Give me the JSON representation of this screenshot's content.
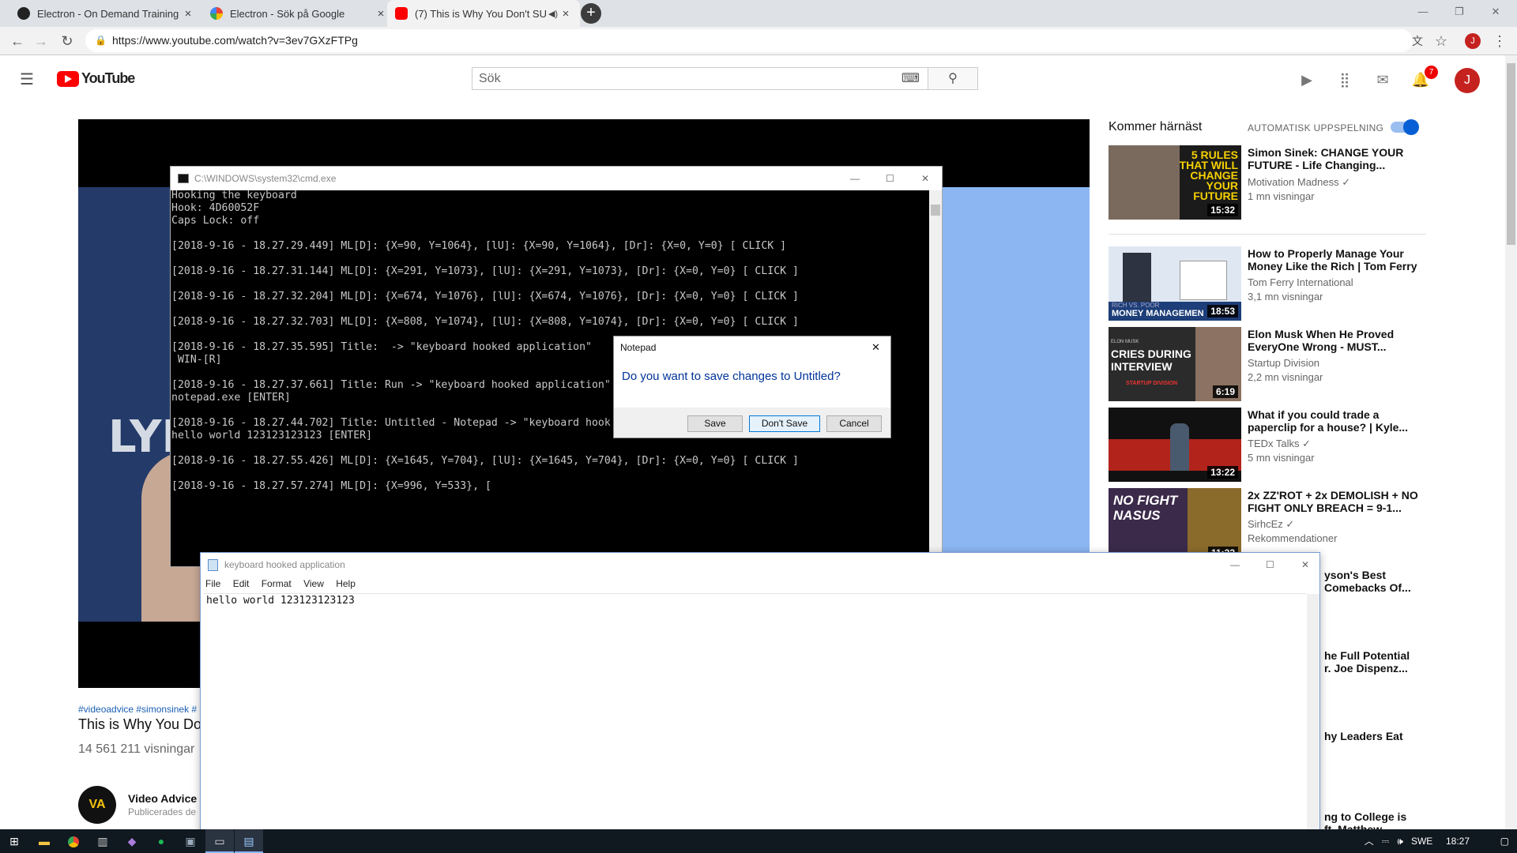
{
  "tabs": [
    {
      "title": "Electron - On Demand Training",
      "close": "×"
    },
    {
      "title": "Electron - Sök på Google",
      "close": "×"
    },
    {
      "title": "(7) This is Why You Don't SU",
      "close": "×"
    }
  ],
  "newtab": "+",
  "url": "https://www.youtube.com/watch?v=3ev7GXzFTPg",
  "profile_initial": "J",
  "yt": {
    "logo": "YouTube",
    "search_placeholder": "Sök",
    "notifications": "7",
    "avatar": "J"
  },
  "video": {
    "hashtags": "#videoadvice #simonsinek #",
    "title": "This is Why You Do",
    "views": "14 561 211 visningar",
    "channel": "Video Advice",
    "channel_logo": "VA",
    "published": "Publicerades de",
    "overlay_letters": "LYE"
  },
  "sidebar": {
    "up_next": "Kommer härnäst",
    "autoplay": "AUTOMATISK UPPSPELNING",
    "items": [
      {
        "title1": "Simon Sinek: CHANGE YOUR",
        "title2": "FUTURE - Life Changing...",
        "channel": "Motivation Madness ✓",
        "views": "1 mn visningar",
        "duration": "15:32",
        "thumb_text": "5 RULES THAT WILL CHANGE YOUR FUTURE"
      },
      {
        "title1": "How to Properly Manage Your",
        "title2": "Money Like the Rich | Tom Ferry",
        "channel": "Tom Ferry International",
        "views": "3,1 mn visningar",
        "duration": "18:53",
        "thumb_text": "MONEY MANAGEMEN",
        "thumb_sub": "RICH VS. POOR"
      },
      {
        "title1": "Elon Musk When He Proved",
        "title2": "EveryOne Wrong - MUST...",
        "channel": "Startup Division",
        "views": "2,2 mn visningar",
        "duration": "6:19",
        "thumb_text": "CRIES DURING INTERVIEW",
        "thumb_sub": "ELON MUSK",
        "thumb_foot": "STARTUP DIVISION"
      },
      {
        "title1": "What if you could trade a",
        "title2": "paperclip for a house? | Kyle...",
        "channel": "TEDx Talks ✓",
        "views": "5 mn visningar",
        "duration": "13:22"
      },
      {
        "title1": "2x ZZ'ROT + 2x DEMOLISH + NO",
        "title2": "FIGHT ONLY BREACH = 9-1...",
        "channel": "SirhcEz ✓",
        "views": "Rekommendationer",
        "duration": "11:22",
        "thumb_text": "NO FIGHT NASUS"
      }
    ],
    "partial": [
      {
        "l1": "yson's Best",
        "l2": "Comebacks Of..."
      },
      {
        "l1": "he Full Potential",
        "l2": "r. Joe Dispenz..."
      },
      {
        "l1": "hy Leaders Eat",
        "l2": ""
      },
      {
        "l1": "ng to College is",
        "l2": "ft. Matthew"
      }
    ]
  },
  "cmd": {
    "title": "C:\\WINDOWS\\system32\\cmd.exe",
    "lines": [
      "Hooking the keyboard",
      "Hook: 4D60052F",
      "Caps Lock: off",
      "",
      "[2018-9-16 - 18.27.29.449] ML[D]: {X=90, Y=1064}, [lU]: {X=90, Y=1064}, [Dr]: {X=0, Y=0} [ CLICK ]",
      "",
      "[2018-9-16 - 18.27.31.144] ML[D]: {X=291, Y=1073}, [lU]: {X=291, Y=1073}, [Dr]: {X=0, Y=0} [ CLICK ]",
      "",
      "[2018-9-16 - 18.27.32.204] ML[D]: {X=674, Y=1076}, [lU]: {X=674, Y=1076}, [Dr]: {X=0, Y=0} [ CLICK ]",
      "",
      "[2018-9-16 - 18.27.32.703] ML[D]: {X=808, Y=1074}, [lU]: {X=808, Y=1074}, [Dr]: {X=0, Y=0} [ CLICK ]",
      "",
      "[2018-9-16 - 18.27.35.595] Title:  -> \"keyboard hooked application\"",
      " WIN-[R]",
      "",
      "[2018-9-16 - 18.27.37.661] Title: Run -> \"keyboard hooked application\"",
      "notepad.exe [ENTER]",
      "",
      "[2018-9-16 - 18.27.44.702] Title: Untitled - Notepad -> \"keyboard hook",
      "hello world 123123123123 [ENTER]",
      "",
      "[2018-9-16 - 18.27.55.426] ML[D]: {X=1645, Y=704}, [lU]: {X=1645, Y=704}, [Dr]: {X=0, Y=0} [ CLICK ]",
      "",
      "[2018-9-16 - 18.27.57.274] ML[D]: {X=996, Y=533}, ["
    ]
  },
  "dialog": {
    "title": "Notepad",
    "message": "Do you want to save changes to Untitled?",
    "save": "Save",
    "dont_save": "Don't Save",
    "cancel": "Cancel",
    "close": "✕"
  },
  "notepad": {
    "title": "keyboard hooked application",
    "menu": [
      "File",
      "Edit",
      "Format",
      "View",
      "Help"
    ],
    "content": "hello world 123123123123"
  },
  "taskbar": {
    "lang": "SWE",
    "time": "18:27"
  }
}
